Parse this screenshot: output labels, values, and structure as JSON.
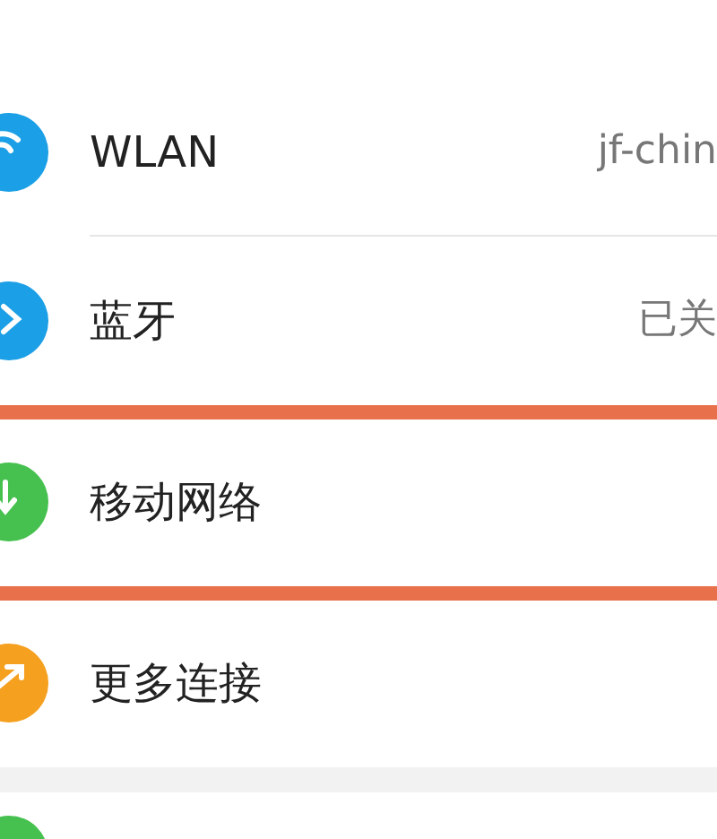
{
  "settings": {
    "items": [
      {
        "kind": "wifi",
        "label": "WLAN",
        "value": "jf-chin",
        "highlighted": false
      },
      {
        "kind": "bluetooth",
        "label": "蓝牙",
        "value": "已关",
        "highlighted": false
      },
      {
        "kind": "mobile",
        "label": "移动网络",
        "highlighted": true
      },
      {
        "kind": "more",
        "label": "更多连接",
        "highlighted": false
      }
    ]
  }
}
